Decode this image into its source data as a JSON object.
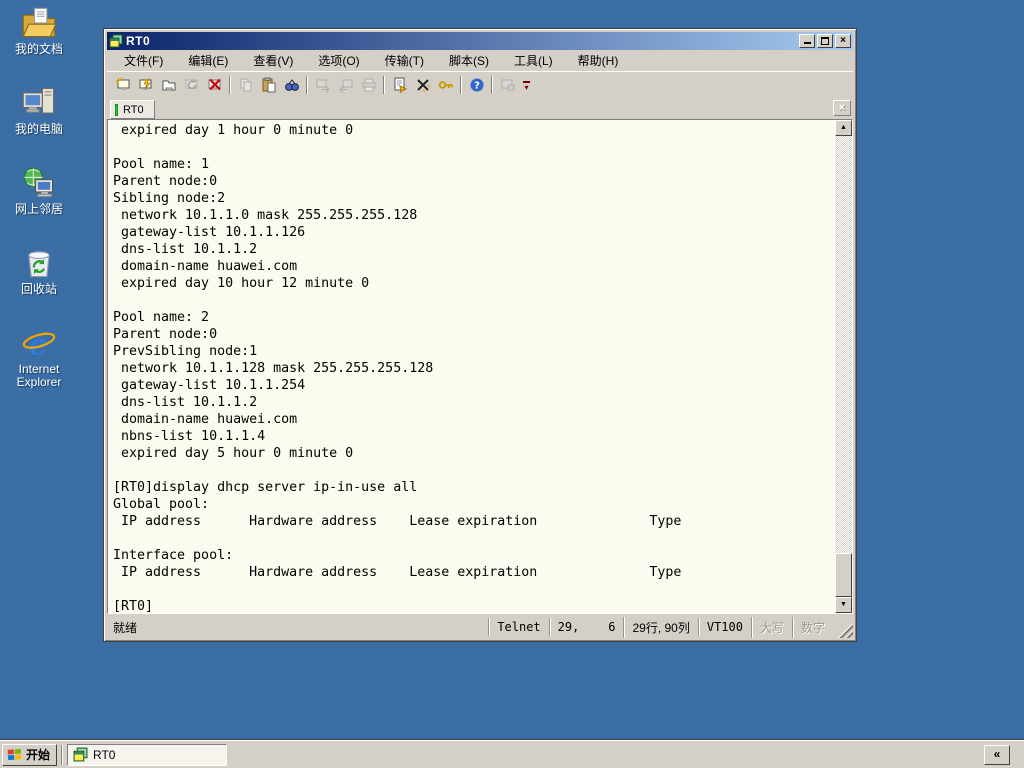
{
  "desktop": {
    "background_color": "#3A6EA5",
    "icons": [
      {
        "name": "my-documents",
        "label": "我的文档"
      },
      {
        "name": "my-computer",
        "label": "我的电脑"
      },
      {
        "name": "network-places",
        "label": "网上邻居"
      },
      {
        "name": "recycle-bin",
        "label": "回收站"
      },
      {
        "name": "internet-explorer",
        "label": "Internet\nExplorer"
      }
    ]
  },
  "window": {
    "title": "RT0",
    "title_gradient": [
      "#0A246A",
      "#A6CAF0"
    ],
    "controls": {
      "minimize": "",
      "maximize": "",
      "close": "×"
    },
    "menu": [
      "文件(F)",
      "编辑(E)",
      "查看(V)",
      "选项(O)",
      "传输(T)",
      "脚本(S)",
      "工具(L)",
      "帮助(H)"
    ],
    "toolbar_icons": [
      "quick-connect-icon",
      "connect-icon",
      "sessions-icon",
      "reconnect-icon",
      "disconnect-icon",
      "copy-icon",
      "paste-icon",
      "find-icon",
      "send-file-icon",
      "receive-file-icon",
      "print-icon",
      "properties-icon",
      "session-options-icon",
      "key-icon",
      "help-icon",
      "capture-icon",
      "toolbar-overflow-icon"
    ],
    "tab": {
      "label": "RT0",
      "indicator_color": "#33cc33",
      "close": "×"
    },
    "terminal": {
      "lines": [
        " expired day 1 hour 0 minute 0",
        "",
        "Pool name: 1",
        "Parent node:0",
        "Sibling node:2",
        " network 10.1.1.0 mask 255.255.255.128",
        " gateway-list 10.1.1.126",
        " dns-list 10.1.1.2",
        " domain-name huawei.com",
        " expired day 10 hour 12 minute 0",
        "",
        "Pool name: 2",
        "Parent node:0",
        "PrevSibling node:1",
        " network 10.1.1.128 mask 255.255.255.128",
        " gateway-list 10.1.1.254",
        " dns-list 10.1.1.2",
        " domain-name huawei.com",
        " nbns-list 10.1.1.4",
        " expired day 5 hour 0 minute 0",
        "",
        "[RT0]display dhcp server ip-in-use all",
        "Global pool:",
        " IP address      Hardware address    Lease expiration              Type",
        "",
        "Interface pool:",
        " IP address      Hardware address    Lease expiration              Type",
        "",
        "[RT0]"
      ]
    },
    "status": {
      "ready": "就绪",
      "protocol": "Telnet",
      "cursor": "29,    6",
      "size": "29行, 90列",
      "emulation": "VT100",
      "caps": "大写",
      "num": "数字"
    }
  },
  "taskbar": {
    "start_label": "开始",
    "tasks": [
      {
        "label": "RT0"
      }
    ],
    "collapse_label": "«"
  }
}
